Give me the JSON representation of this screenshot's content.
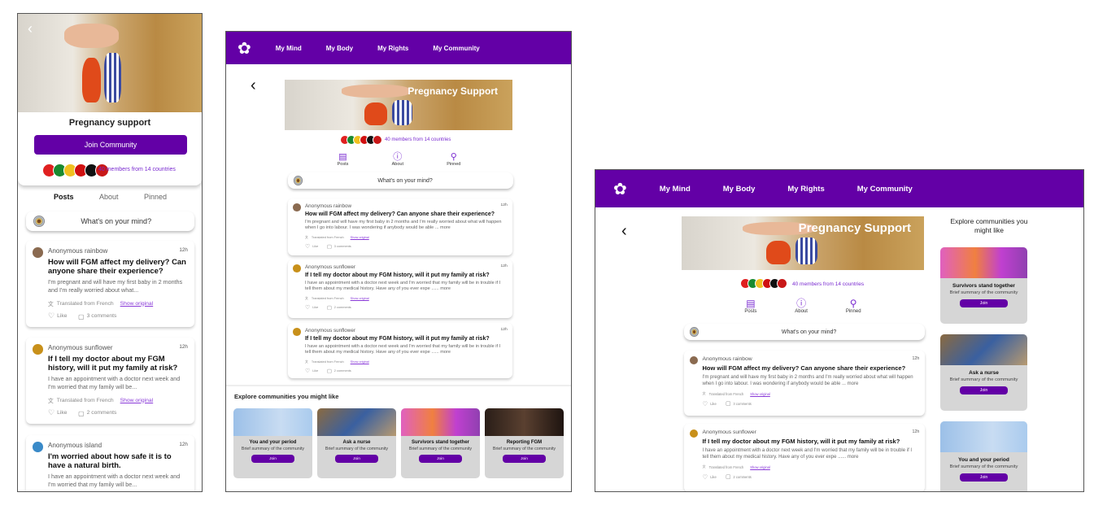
{
  "nav": {
    "items": [
      "My Mind",
      "My Body",
      "My Rights",
      "My Community"
    ],
    "logo_icon": "lotus-icon"
  },
  "colors": {
    "brand": "#6300a6",
    "link": "#7a2bd0"
  },
  "community": {
    "title": "Pregnancy support",
    "banner_title": "Pregnancy Support",
    "join_label": "Join Community",
    "members": "40 members from 14 countries",
    "tabs": [
      "Posts",
      "About",
      "Pinned"
    ],
    "composer_placeholder": "What's on your mind?"
  },
  "posts": [
    {
      "author": "Anonymous rainbow",
      "time": "12h",
      "title": "How will FGM affect my delivery? Can anyone share their experience?",
      "body_short": "I'm pregnant and will have my first baby in 2 months and I'm really worried about what...",
      "body_long": "I'm pregnant and will have my first baby in 2 months and I'm really worried about what will happen when I go into labour. I was wondering if anybody would be able ... more",
      "translated": "Translated from French",
      "show_original": "Show original",
      "like": "Like",
      "comments": "3 comments",
      "avatar_color": "#8a6a50"
    },
    {
      "author": "Anonymous sunflower",
      "time": "12h",
      "title": "If I tell my doctor about my FGM history, will it put my family at risk?",
      "body_short": "I have an appointment with a doctor next week and I'm worried that my family will be...",
      "body_long": "I have an appointment with a doctor next week and I'm worried that my family will be in trouble if I tell them about my medical history. Have any of you ever expe ...... more",
      "translated": "Translated from French",
      "show_original": "Show original",
      "like": "Like",
      "comments": "2 comments",
      "avatar_color": "#c8901a"
    },
    {
      "author": "Anonymous island",
      "time": "12h",
      "title": "I'm worried about how safe it is to have a natural birth.",
      "body_short": "I have an appointment with a doctor next week and I'm worried that my family will be...",
      "avatar_color": "#3a8ac8"
    }
  ],
  "explore": {
    "title": "Explore communities you might like",
    "cards": [
      {
        "name": "You and your period",
        "summary": "Brief summary of the community",
        "join": "Join"
      },
      {
        "name": "Ask a nurse",
        "summary": "Brief summary of the community",
        "join": "Join"
      },
      {
        "name": "Survivors stand together",
        "summary": "Brief summary of the community",
        "join": "Join"
      },
      {
        "name": "Reporting FGM",
        "summary": "Brief summary of the community",
        "join": "Join"
      }
    ]
  }
}
